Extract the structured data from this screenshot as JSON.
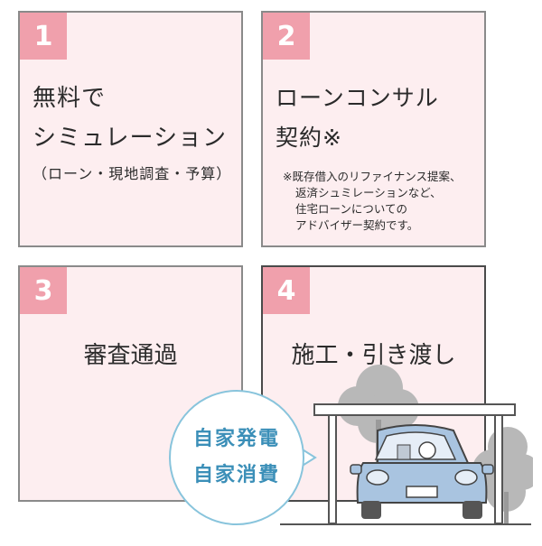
{
  "steps": [
    {
      "number": "1",
      "title_lines": [
        "無料で",
        "シミュレーション"
      ],
      "subtitle": "（ローン・現地調査・予算）"
    },
    {
      "number": "2",
      "title_lines": [
        "ローンコンサル",
        "契約※"
      ],
      "note_lines": [
        "※既存借入のリファイナンス提案、",
        "返済シュミレーションなど、",
        "住宅ローンについての",
        "アドバイザー契約です。"
      ]
    },
    {
      "number": "3",
      "title": "審査通過"
    },
    {
      "number": "4",
      "title": "施工・引き渡し"
    }
  ],
  "bubble": {
    "lines": [
      "自家発電",
      "自家消費"
    ]
  },
  "colors": {
    "card_bg": "#fdeef0",
    "number_badge": "#f0a0ac",
    "bubble_text": "#3b8fb8",
    "car_body": "#a9c4e0",
    "tree": "#b8b8b8"
  }
}
